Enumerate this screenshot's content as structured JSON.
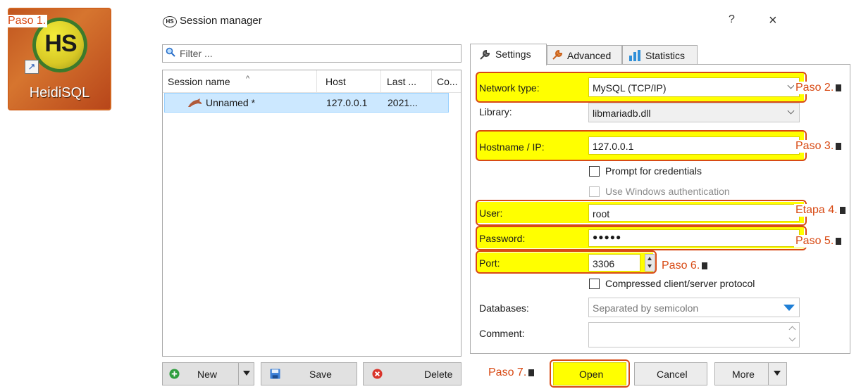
{
  "desktop": {
    "app_name": "HeidiSQL",
    "logo_text": "HS"
  },
  "steps": {
    "s1": "Paso 1.",
    "s2": "Paso 2.",
    "s3": "Paso 3.",
    "s4": "Etapa 4.",
    "s5": "Paso 5.",
    "s6": "Paso 6.",
    "s7": "Paso 7."
  },
  "window": {
    "title": "Session manager",
    "help_label": "?",
    "close_label": "×",
    "app_icon_text": "HS"
  },
  "left": {
    "filter_placeholder": "Filter ...",
    "columns": [
      "Session name",
      "Host",
      "Last ...",
      "Co..."
    ],
    "sort_indicator": "^",
    "sessions": [
      {
        "name": "Unnamed *",
        "host": "127.0.0.1",
        "last": "2021...",
        "comment": ""
      }
    ],
    "buttons": {
      "new": "New",
      "save": "Save",
      "delete": "Delete"
    }
  },
  "tabs": [
    "Settings",
    "Advanced",
    "Statistics"
  ],
  "settings": {
    "network_type_label": "Network type:",
    "network_type_value": "MySQL (TCP/IP)",
    "library_label": "Library:",
    "library_value": "libmariadb.dll",
    "hostname_label": "Hostname / IP:",
    "hostname_value": "127.0.0.1",
    "prompt_credentials": "Prompt for credentials",
    "windows_auth": "Use Windows authentication",
    "user_label": "User:",
    "user_value": "root",
    "password_label": "Password:",
    "password_value": "●●●●●",
    "port_label": "Port:",
    "port_value": "3306",
    "compressed": "Compressed client/server protocol",
    "databases_label": "Databases:",
    "databases_placeholder": "Separated by semicolon",
    "comment_label": "Comment:"
  },
  "actions": {
    "open": "Open",
    "cancel": "Cancel",
    "more": "More"
  },
  "colors": {
    "highlight": "#ffff00",
    "step_text": "#d84a14",
    "selection": "#cce8ff"
  }
}
